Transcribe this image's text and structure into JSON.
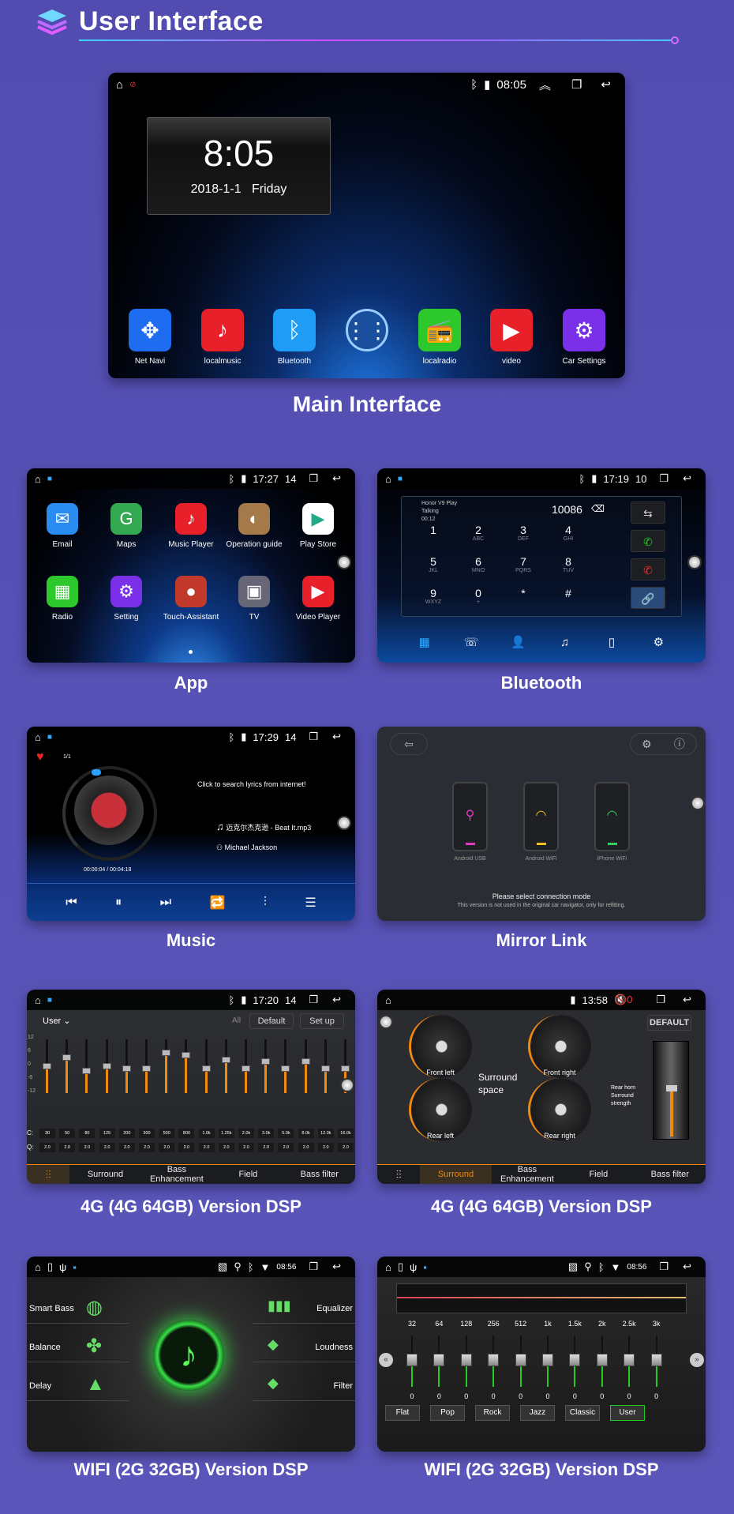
{
  "header": {
    "title": "User Interface",
    "logo_icon": "layers-icon",
    "accent": "#d14cff"
  },
  "main": {
    "caption": "Main Interface",
    "status_time": "08:05",
    "clock_time": "8:05",
    "clock_date": "2018-1-1",
    "clock_day": "Friday",
    "dock": [
      {
        "label": "Net Navi",
        "icon": "compass-icon",
        "color": "#1e6cf0",
        "glyph": "✥"
      },
      {
        "label": "localmusic",
        "icon": "music-note-icon",
        "color": "#e8202a",
        "glyph": "♪"
      },
      {
        "label": "Bluetooth",
        "icon": "bluetooth-icon",
        "color": "#1f9cf5",
        "glyph": "ᛒ"
      },
      {
        "label": "",
        "icon": "app-grid-icon",
        "color": "#1a4f9e",
        "glyph": "⋮⋮"
      },
      {
        "label": "localradio",
        "icon": "radio-icon",
        "color": "#2cc82c",
        "glyph": "📻"
      },
      {
        "label": "video",
        "icon": "play-icon",
        "color": "#e8202a",
        "glyph": "▶"
      },
      {
        "label": "Car Settings",
        "icon": "gear-icon",
        "color": "#7a30e8",
        "glyph": "⚙"
      }
    ]
  },
  "app": {
    "caption": "App",
    "time": "17:27",
    "volume": "14",
    "icons": [
      {
        "label": "Email",
        "icon": "email-icon",
        "color": "#2a8cf0",
        "glyph": "✉"
      },
      {
        "label": "Maps",
        "icon": "maps-icon",
        "color": "#34a853",
        "glyph": "G"
      },
      {
        "label": "Music Player",
        "icon": "music-note-icon",
        "color": "#e8202a",
        "glyph": "♪"
      },
      {
        "label": "Operation guide",
        "icon": "guide-icon",
        "color": "#a57a4a",
        "glyph": "◐"
      },
      {
        "label": "Play Store",
        "icon": "play-store-icon",
        "color": "#ffffff",
        "glyph": "▶"
      },
      {
        "label": "Radio",
        "icon": "radio-icon",
        "color": "#2cc82c",
        "glyph": "▦"
      },
      {
        "label": "Setting",
        "icon": "gear-icon",
        "color": "#7a30e8",
        "glyph": "⚙"
      },
      {
        "label": "Touch-Assistant",
        "icon": "touch-assistant-icon",
        "color": "#c0392b",
        "glyph": "●"
      },
      {
        "label": "TV",
        "icon": "tv-icon",
        "color": "#667",
        "glyph": "▣"
      },
      {
        "label": "Video Player",
        "icon": "play-icon",
        "color": "#e8202a",
        "glyph": "▶"
      }
    ]
  },
  "bluetooth": {
    "caption": "Bluetooth",
    "time": "17:19",
    "volume": "10",
    "device": "Honor V9 Play",
    "call_status": "Talking",
    "call_time": "00:12",
    "number": "10086",
    "keys": [
      {
        "d": "1",
        "l": ""
      },
      {
        "d": "2",
        "l": "ABC"
      },
      {
        "d": "3",
        "l": "DEF"
      },
      {
        "d": "4",
        "l": "GHI"
      },
      {
        "d": "5",
        "l": "JKL"
      },
      {
        "d": "6",
        "l": "MNO"
      },
      {
        "d": "7",
        "l": "PQRS"
      },
      {
        "d": "8",
        "l": "TUV"
      },
      {
        "d": "9",
        "l": "WXYZ"
      },
      {
        "d": "0",
        "l": "+"
      },
      {
        "d": "*",
        "l": ""
      },
      {
        "d": "#",
        "l": ""
      }
    ],
    "side_buttons": [
      "transfer-audio-icon",
      "call-icon",
      "hang-up-icon",
      "link-icon"
    ],
    "nav": [
      {
        "icon": "dialpad-icon",
        "glyph": "▦"
      },
      {
        "icon": "call-log-icon",
        "glyph": "☏"
      },
      {
        "icon": "contacts-icon",
        "glyph": "👤"
      },
      {
        "icon": "bt-music-icon",
        "glyph": "♫"
      },
      {
        "icon": "phone-device-icon",
        "glyph": "▯"
      },
      {
        "icon": "bt-settings-icon",
        "glyph": "⚙"
      }
    ]
  },
  "music": {
    "caption": "Music",
    "time": "17:29",
    "volume": "14",
    "track_index": "1/1",
    "lyrics_hint": "Click to search lyrics from internet!",
    "track": "迈克尔杰克逊 - Beat It.mp3",
    "artist": "Michael Jackson",
    "progress": "00:00:04 / 00:04:18",
    "controls": [
      {
        "icon": "previous-icon",
        "glyph": "⏮"
      },
      {
        "icon": "pause-icon",
        "glyph": "⏸"
      },
      {
        "icon": "next-icon",
        "glyph": "⏭"
      },
      {
        "icon": "repeat-icon",
        "glyph": "🔁"
      },
      {
        "icon": "equalizer-icon",
        "glyph": "⫶"
      },
      {
        "icon": "playlist-icon",
        "glyph": "☰"
      }
    ]
  },
  "mirror": {
    "caption": "Mirror Link",
    "modes": [
      {
        "label": "Android USB",
        "icon": "usb-icon",
        "color": "#e03cc0",
        "glyph": "⚲"
      },
      {
        "label": "Android WiFi",
        "icon": "wifi-icon",
        "color": "#f0c020",
        "glyph": "◠"
      },
      {
        "label": "iPhone WiFi",
        "icon": "wifi-icon",
        "color": "#30d060",
        "glyph": "◠"
      }
    ],
    "prompt": "Please select connection mode",
    "note": "This version is not used in the original car navigator, only for refitting."
  },
  "dsp_eq": {
    "caption": "4G (4G 64GB) Version DSP",
    "time": "17:20",
    "volume": "14",
    "preset": "User",
    "btn_all": "All",
    "btn_default": "Default",
    "btn_setup": "Set up",
    "y_ticks": [
      "12",
      "6",
      "0",
      "-6",
      "-12"
    ],
    "row_c": "C:",
    "row_q": "Q:",
    "freqs": [
      "30",
      "50",
      "80",
      "125",
      "200",
      "300",
      "500",
      "800",
      "1.0k",
      "1.25k",
      "2.0k",
      "3.0k",
      "5.0k",
      "8.0k",
      "12.0k",
      "16.0k"
    ],
    "gains": [
      0,
      4,
      -2,
      0,
      -1,
      -1,
      6,
      5,
      -1,
      3,
      -1,
      2,
      -1,
      2,
      -1,
      -1
    ],
    "q": [
      "2.0",
      "2.0",
      "2.0",
      "2.0",
      "2.0",
      "2.0",
      "2.0",
      "2.0",
      "2.0",
      "2.0",
      "2.0",
      "2.0",
      "2.0",
      "2.0",
      "2.0",
      "2.0"
    ],
    "tabs": [
      "",
      "Surround",
      "Bass Enhancement",
      "Field",
      "Bass filter"
    ],
    "active_tab": 0,
    "accent": "#f08a10"
  },
  "dsp_surround": {
    "caption": "4G (4G 64GB) Version DSP",
    "time": "13:58",
    "volume": "0",
    "btn_default": "DEFAULT",
    "center_label": "Surround space",
    "knobs": [
      "Front left",
      "Front right",
      "Rear left",
      "Rear right"
    ],
    "slider_label": "Rear horn Surround strength",
    "tabs": [
      "",
      "Surround",
      "Bass Enhancement",
      "Field",
      "Bass filter"
    ],
    "active_tab": 1
  },
  "dsp_wifi_menu": {
    "caption": "WIFI (2G 32GB) Version DSP",
    "time": "08:56",
    "left": [
      {
        "label": "Smart Bass",
        "icon": "smart-bass-icon"
      },
      {
        "label": "Balance",
        "icon": "balance-icon"
      },
      {
        "label": "Delay",
        "icon": "delay-icon"
      }
    ],
    "right": [
      {
        "label": "Equalizer",
        "icon": "equalizer-icon"
      },
      {
        "label": "Loudness",
        "icon": "loudness-icon"
      },
      {
        "label": "Filter",
        "icon": "filter-icon"
      }
    ],
    "accent": "#38e048"
  },
  "dsp_wifi_eq": {
    "caption": "WIFI (2G 32GB) Version DSP",
    "time": "08:56",
    "freqs": [
      "32",
      "64",
      "128",
      "256",
      "512",
      "1k",
      "1.5k",
      "2k",
      "2.5k",
      "3k"
    ],
    "values": [
      "0",
      "0",
      "0",
      "0",
      "0",
      "0",
      "0",
      "0",
      "0",
      "0"
    ],
    "presets": [
      "Flat",
      "Pop",
      "Rock",
      "Jazz",
      "Classic",
      "User"
    ],
    "active_preset": "User"
  }
}
